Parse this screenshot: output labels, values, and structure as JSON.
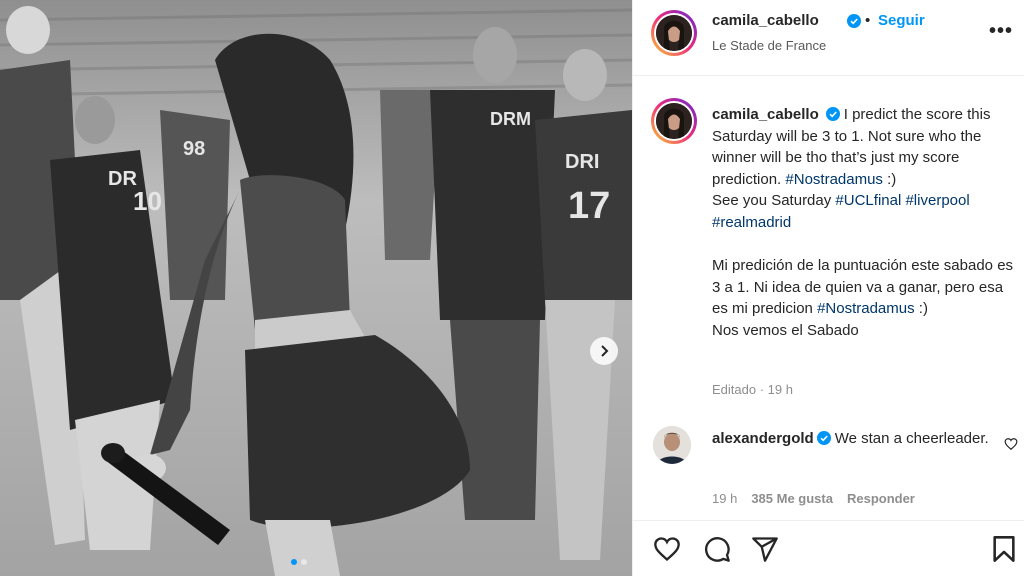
{
  "post": {
    "username": "camila_cabello",
    "separator": "•",
    "follow_label": "Seguir",
    "location": "Le Stade de France",
    "more_label": "•••"
  },
  "caption": {
    "username": "camila_cabello",
    "l1_text": "I predict the score this Saturday will be 3 to 1. Not sure who the winner will be tho that’s just my score prediction.",
    "l1_tag": "#Nostradamus",
    "l1_end": ":)",
    "l2_text": "See you Saturday",
    "l2_tag1": "#UCLfinal",
    "l2_tag2": "#liverpool",
    "l2_tag3": "#realmadrid",
    "l3_text": "Mi predición de la puntuación este sabado es 3 a 1. Ni idea de quien va a ganar, pero esa es mi predicion",
    "l3_tag": "#Nostradamus",
    "l3_end": ":)",
    "l4_text": "Nos vemos el Sabado",
    "edited": "Editado · 19 h"
  },
  "comment": {
    "username": "alexandergold",
    "text": "We stan a cheerleader.",
    "time": "19 h",
    "likes": "385 Me gusta",
    "reply_label": "Responder"
  },
  "photo": {
    "jersey_a": "98",
    "jersey_b": "17",
    "jersey_b_top": "DRI",
    "jersey_c": "10",
    "jersey_c_top": "DR",
    "jersey_d_top": "DRM"
  },
  "colors": {
    "accent": "#0095f6",
    "hashtag": "#00376b",
    "text": "#262626",
    "muted": "#8e8e8e"
  },
  "icons": [
    "verified-badge-icon",
    "more-options-icon",
    "heart-icon",
    "comment-icon",
    "share-icon",
    "bookmark-icon",
    "chevron-right-icon"
  ]
}
